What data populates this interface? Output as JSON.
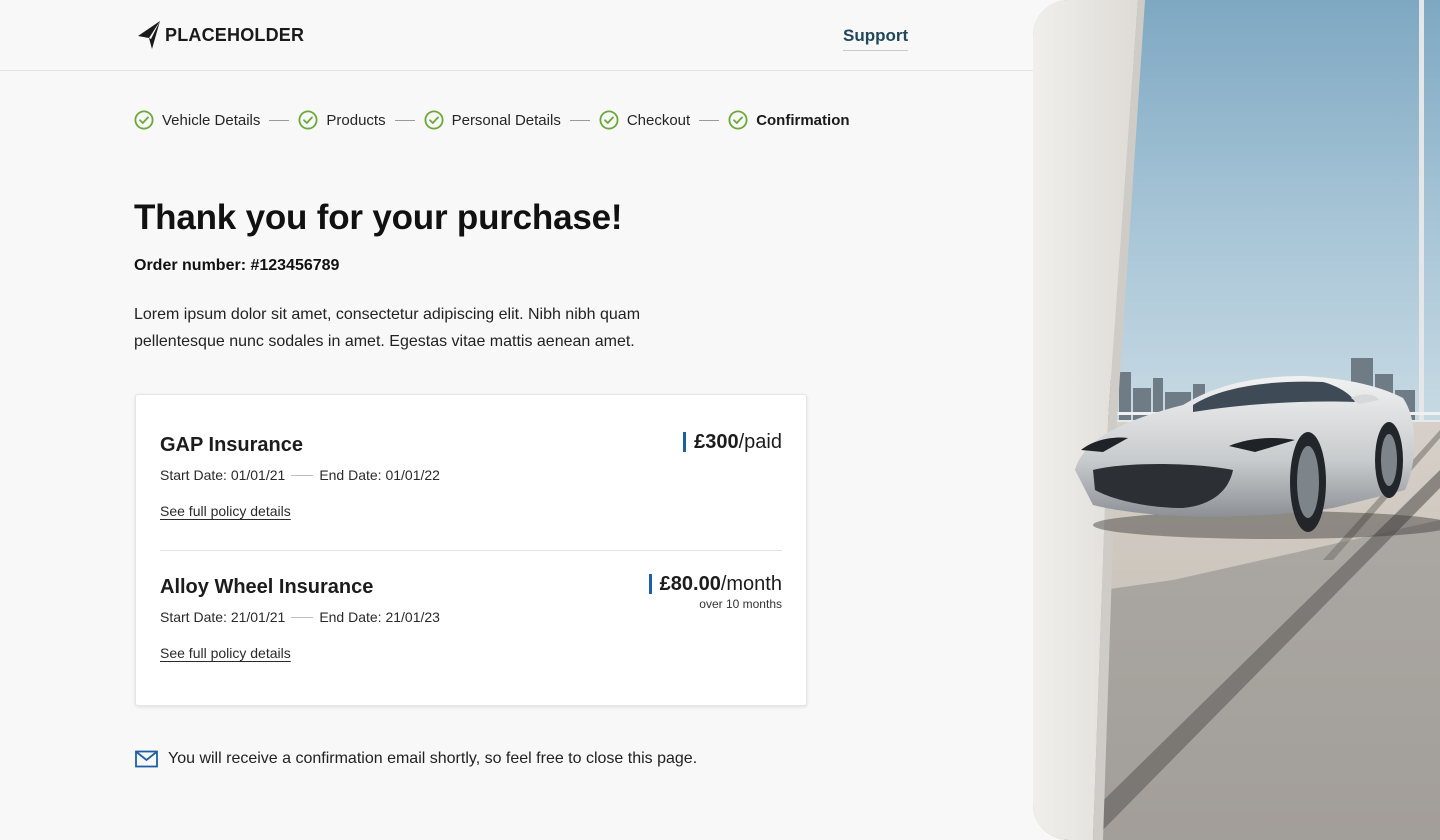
{
  "header": {
    "logo_text": "PLACEHOLDER",
    "support_label": "Support"
  },
  "stepper": [
    {
      "label": "Vehicle Details",
      "state": "done"
    },
    {
      "label": "Products",
      "state": "done"
    },
    {
      "label": "Personal Details",
      "state": "done"
    },
    {
      "label": "Checkout",
      "state": "done"
    },
    {
      "label": "Confirmation",
      "state": "current"
    }
  ],
  "main": {
    "title": "Thank you for your purchase!",
    "order_number": "Order number: #123456789",
    "intro": "Lorem ipsum dolor sit amet, consectetur adipiscing elit. Nibh nibh quam pellentesque nunc sodales in amet. Egestas vitae mattis aenean amet."
  },
  "policies": [
    {
      "name": "GAP Insurance",
      "start_label": "Start Date:",
      "start_date": "01/01/21",
      "end_label": "End Date:",
      "end_date": "01/01/22",
      "link": "See full policy details",
      "amount": "£300",
      "unit": "/paid",
      "note": ""
    },
    {
      "name": "Alloy Wheel Insurance",
      "start_label": "Start Date:",
      "start_date": "21/01/21",
      "end_label": "End Date:",
      "end_date": "21/01/23",
      "link": "See full policy details",
      "amount": "£80.00",
      "unit": "/month",
      "note": "over 10 months"
    }
  ],
  "confirmation_note": "You will receive a confirmation email shortly, so feel free to close this page.",
  "icons": {
    "logo": "placeholder-logo-icon",
    "step": "check-circle-icon",
    "note": "envelope-icon"
  },
  "colors": {
    "accent_green": "#6aa837",
    "support_link": "#21475b",
    "price_bar": "#1d5fa6",
    "envelope": "#1d5fa6"
  }
}
